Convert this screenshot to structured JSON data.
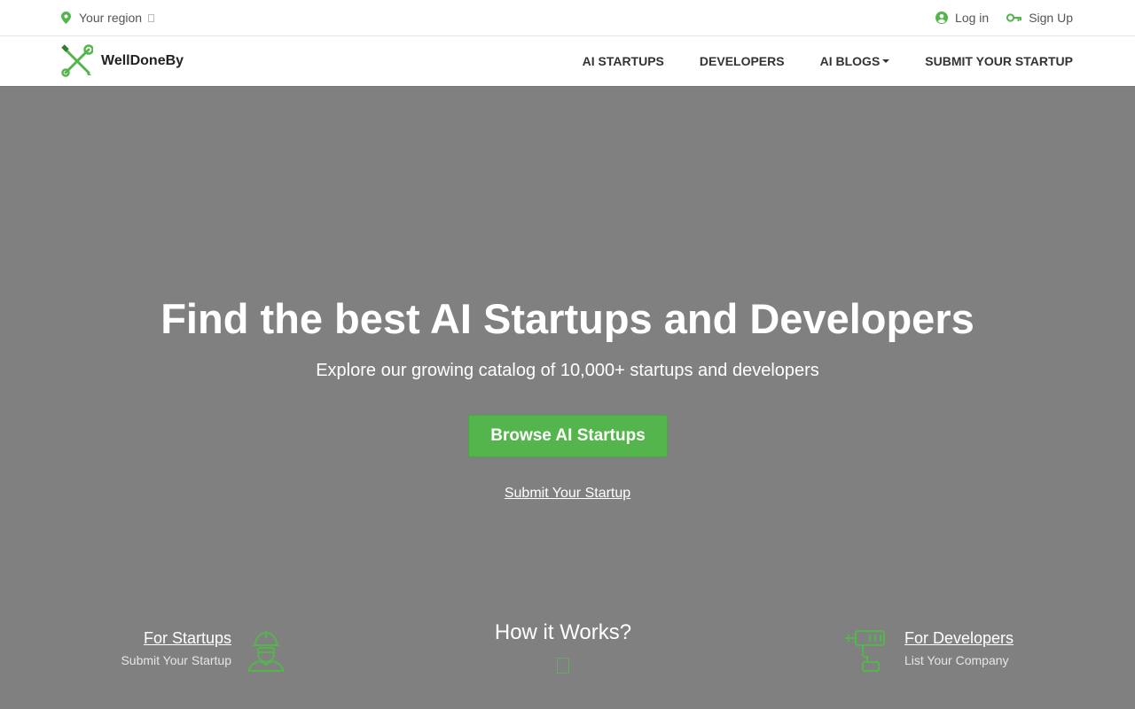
{
  "topbar": {
    "region_label": "Your region",
    "login_label": "Log in",
    "signup_label": "Sign Up"
  },
  "nav": {
    "brand": "WellDoneBy",
    "items": [
      {
        "label": "AI STARTUPS"
      },
      {
        "label": "DEVELOPERS"
      },
      {
        "label": "AI BLOGS"
      },
      {
        "label": "SUBMIT YOUR STARTUP"
      }
    ]
  },
  "hero": {
    "title": "Find the best AI Startups and Developers",
    "subtitle": "Explore our growing catalog of 10,000+ startups and developers",
    "cta_label": "Browse AI Startups",
    "link_label": "Submit Your Startup"
  },
  "features": {
    "startups": {
      "title": "For Startups",
      "subtitle": "Submit Your Startup"
    },
    "how_it_works": "How it Works?",
    "developers": {
      "title": "For Developers",
      "subtitle": "List Your Company"
    }
  },
  "colors": {
    "accent": "#55b54d",
    "hero_overlay": "#808080"
  },
  "icons": [
    "map-pin-icon",
    "user-circle-icon",
    "key-icon",
    "tools-logo-icon",
    "worker-icon",
    "drill-icon"
  ]
}
